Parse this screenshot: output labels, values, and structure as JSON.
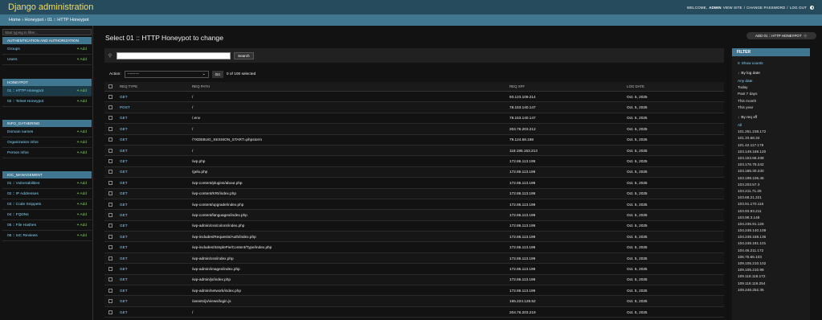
{
  "header": {
    "brand": "Django administration",
    "welcome": "WELCOME,",
    "user": "ADMIN",
    "view_site": "VIEW SITE",
    "change_password": "CHANGE PASSWORD",
    "logout": "LOG OUT",
    "sep": "/"
  },
  "breadcrumbs": "Home › Honeypot › 01 :: HTTP Honeypot",
  "sidebar": {
    "filter_placeholder": "Start typing to filter...",
    "add_label": "Add",
    "apps": [
      {
        "caption": "AUTHENTICATION AND AUTHORIZATION",
        "models": [
          "Groups",
          "Users"
        ]
      },
      {
        "caption": "HONEYPOT",
        "models": [
          "01 :: HTTP Honeypot",
          "02 :: Telnet Honeypot"
        ]
      },
      {
        "caption": "INFO_GATHERING",
        "models": [
          "Domain names",
          "Organization infos",
          "Person infos"
        ]
      },
      {
        "caption": "IOC_MANAGEMENT",
        "models": [
          "01 :: Vulnerabilities",
          "02 :: IP Addresses",
          "03 :: Code Snippets",
          "04 :: FQDNs",
          "05 :: File Hashes",
          "06 :: IoC Reviews"
        ]
      }
    ]
  },
  "content": {
    "title": "Select 01 :: HTTP Honeypot to change",
    "add_button": "ADD 01 :: HTTP HONEYPOT",
    "search_button": "Search",
    "action_label": "Action:",
    "action_value": "---------",
    "go_button": "Go",
    "selected_count": "0 of 100 selected"
  },
  "table": {
    "headers": [
      "REQ TYPE",
      "REQ PATH",
      "REQ XFF",
      "LOG DATE"
    ],
    "rows": [
      [
        "GET",
        "/",
        "93.123.109.214",
        "Oct. 5, 2025"
      ],
      [
        "POST",
        "/",
        "78.153.140.147",
        "Oct. 5, 2025"
      ],
      [
        "GET",
        "/.env",
        "78.153.140.147",
        "Oct. 5, 2025"
      ],
      [
        "GET",
        "/",
        "204.76.203.212",
        "Oct. 5, 2025"
      ],
      [
        "GET",
        "/?XDEBUG_SESSION_START=phpstorm",
        "79.124.58.198",
        "Oct. 5, 2025"
      ],
      [
        "GET",
        "/",
        "118.195.153.213",
        "Oct. 5, 2025"
      ],
      [
        "GET",
        "/wp.php",
        "172.86.113.199",
        "Oct. 5, 2025"
      ],
      [
        "GET",
        "/gelu.php",
        "172.86.113.199",
        "Oct. 5, 2025"
      ],
      [
        "GET",
        "/wp-content/plugins/about.php",
        "172.86.113.199",
        "Oct. 5, 2025"
      ],
      [
        "GET",
        "/wp-content/KRI/index.php",
        "172.86.113.199",
        "Oct. 5, 2025"
      ],
      [
        "GET",
        "/wp-content/upgrade/index.php",
        "172.86.113.199",
        "Oct. 5, 2025"
      ],
      [
        "GET",
        "/wp-content/languages/index.php",
        "172.86.113.199",
        "Oct. 5, 2025"
      ],
      [
        "GET",
        "/wp-admin/css/colors/index.php",
        "172.86.113.199",
        "Oct. 5, 2025"
      ],
      [
        "GET",
        "/wp-includes/Requests/Auth/index.php",
        "172.86.113.199",
        "Oct. 5, 2025"
      ],
      [
        "GET",
        "/wp-includes/SimplePie/Content/Type/index.php",
        "172.86.113.199",
        "Oct. 5, 2025"
      ],
      [
        "GET",
        "/wp-admin/css/index.php",
        "172.86.113.199",
        "Oct. 5, 2025"
      ],
      [
        "GET",
        "/wp-admin/images/index.php",
        "172.86.113.199",
        "Oct. 5, 2025"
      ],
      [
        "GET",
        "/wp-admin/js/index.php",
        "172.86.113.199",
        "Oct. 5, 2025"
      ],
      [
        "GET",
        "/wp-admin/network/index.php",
        "172.86.113.199",
        "Oct. 5, 2025"
      ],
      [
        "GET",
        "/assets/js/views/login.js",
        "165.224.128.52",
        "Oct. 5, 2025"
      ],
      [
        "GET",
        "/",
        "204.76.203.219",
        "Oct. 5, 2025"
      ]
    ]
  },
  "filter": {
    "title": "FILTER",
    "show_counts": "Show counts",
    "by_log_date": "By log date",
    "date_options": [
      "Any date",
      "Today",
      "Past 7 days",
      "This month",
      "This year"
    ],
    "by_req_xff": "By req xff",
    "xff_options": [
      "All",
      "101.251.238.172",
      "101.33.68.34",
      "101.42.117.179",
      "103.149.169.120",
      "103.153.68.238",
      "103.176.78.242",
      "103.186.30.230",
      "103.199.106.46",
      "103.203.57.3",
      "103.211.71.25",
      "103.68.21.221",
      "103.91.170.116",
      "103.93.93.211",
      "103.99.3.148",
      "104.236.91.126",
      "104.248.140.108",
      "104.248.158.136",
      "104.248.181.101",
      "104.46.211.172",
      "106.75.66.103",
      "109.105.210.102",
      "109.105.210.98",
      "109.118.118.172",
      "109.118.119.254",
      "109.248.252.35"
    ]
  },
  "colors": {
    "header_bg": "#264b5d",
    "brand": "#f5dd5d",
    "accent": "#417690",
    "link": "#81d4fa",
    "add": "#7ec95f"
  }
}
